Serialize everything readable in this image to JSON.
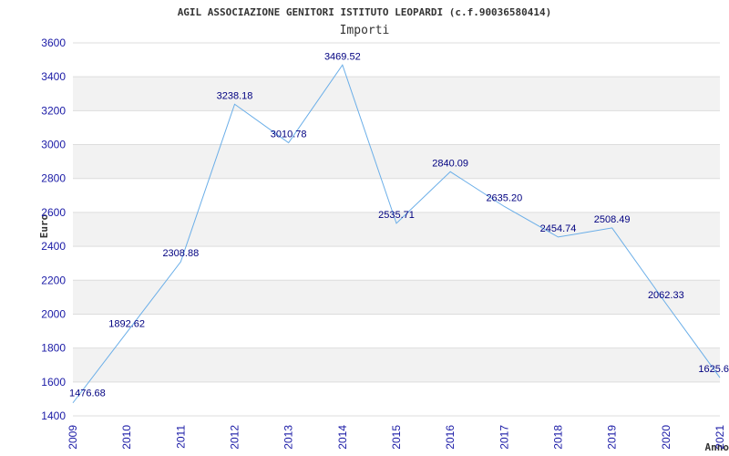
{
  "chart_data": {
    "type": "line",
    "title": "AGIL ASSOCIAZIONE GENITORI ISTITUTO LEOPARDI (c.f.90036580414)",
    "subtitle": "Importi",
    "xlabel": "Anno",
    "ylabel": "Euro",
    "ylim": [
      1400,
      3600
    ],
    "yticks": [
      1400,
      1600,
      1800,
      2000,
      2200,
      2400,
      2600,
      2800,
      3000,
      3200,
      3400,
      3600
    ],
    "grid": true,
    "x": [
      "2009",
      "2010",
      "2011",
      "2012",
      "2013",
      "2014",
      "2015",
      "2016",
      "2017",
      "2018",
      "2019",
      "2020",
      "2021"
    ],
    "series": [
      {
        "values": [
          1476.68,
          1892.62,
          2308.88,
          3238.18,
          3010.78,
          3469.52,
          2535.71,
          2840.09,
          2635.2,
          2454.74,
          2508.49,
          2062.33,
          1625.6
        ],
        "labels": [
          "1476.68",
          "1892.62",
          "2308.88",
          "3238.18",
          "3010.78",
          "3469.52",
          "2535.71",
          "2840.09",
          "2635.20",
          "2454.74",
          "2508.49",
          "2062.33",
          "1625.6"
        ]
      }
    ],
    "colors": {
      "line": "#6aaee8",
      "band": "#f2f2f2",
      "grid": "#dddddd",
      "axis_text": "#1a1aa6",
      "label_text": "#000080"
    }
  }
}
